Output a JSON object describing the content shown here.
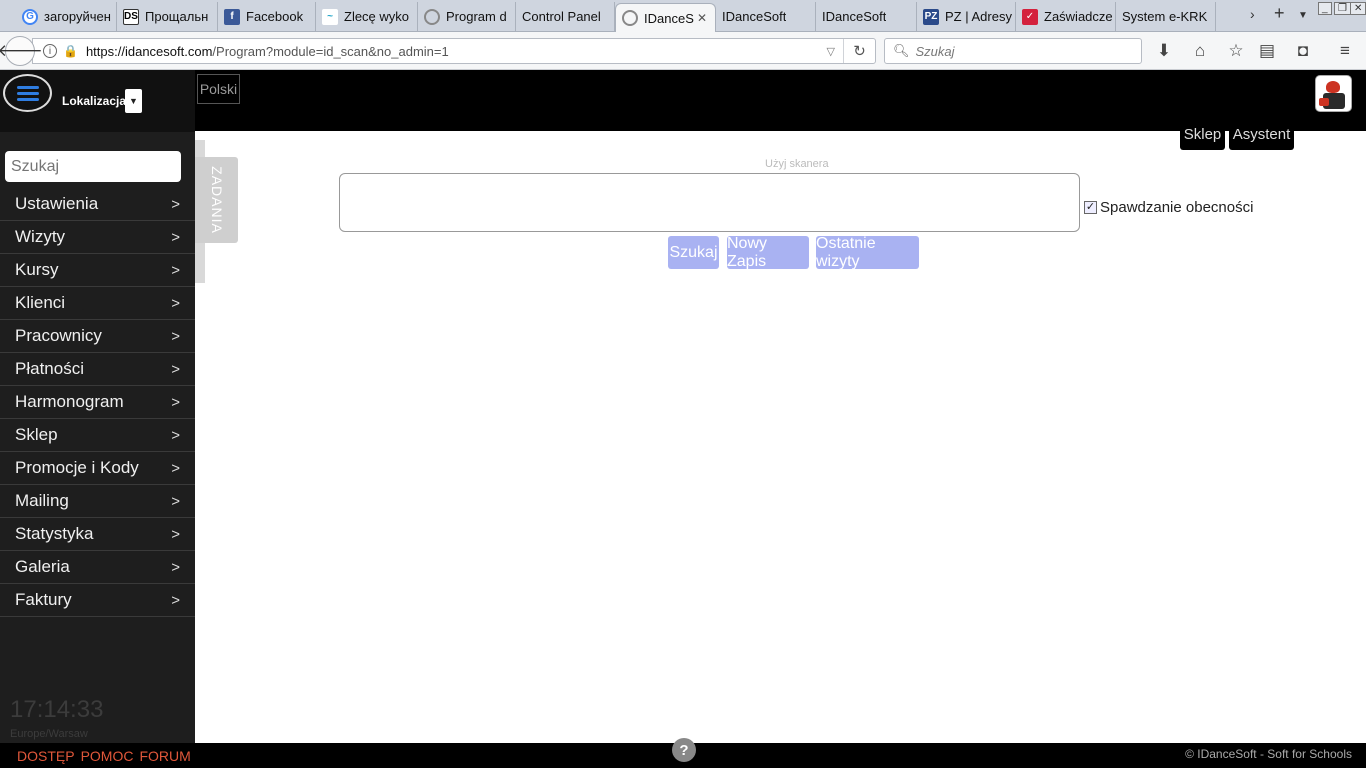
{
  "browser": {
    "tabs": [
      {
        "title": "загоруйчен",
        "fav": "G",
        "cls": "fav-g"
      },
      {
        "title": "Прощальн",
        "fav": "DS",
        "cls": "fav-ds"
      },
      {
        "title": "Facebook",
        "fav": "f",
        "cls": "fav-fb"
      },
      {
        "title": "Zlecę wyko",
        "fav": "~",
        "cls": "fav-z"
      },
      {
        "title": "Program d",
        "fav": "",
        "cls": "fav-ring"
      },
      {
        "title": "Control Panel",
        "fav": "",
        "cls": ""
      },
      {
        "title": "IDanceS",
        "fav": "",
        "cls": "fav-ring",
        "active": true
      },
      {
        "title": "IDanceSoft",
        "fav": "",
        "cls": ""
      },
      {
        "title": "IDanceSoft",
        "fav": "",
        "cls": ""
      },
      {
        "title": "PZ | Adresy",
        "fav": "PZ",
        "cls": "fav-pz"
      },
      {
        "title": "Zaświadcze",
        "fav": "✓",
        "cls": "fav-za"
      },
      {
        "title": "System e-KRK",
        "fav": "",
        "cls": ""
      }
    ],
    "url_host": "https://idancesoft.com",
    "url_path": "/Program?module=id_scan&no_admin=1",
    "search_placeholder": "Szukaj"
  },
  "sidebar": {
    "location_label": "Lokalizacja",
    "search_placeholder": "Szukaj",
    "menu": [
      {
        "label": "Ustawienia"
      },
      {
        "label": "Wizyty"
      },
      {
        "label": "Kursy"
      },
      {
        "label": "Klienci"
      },
      {
        "label": "Pracownicy"
      },
      {
        "label": "Płatności"
      },
      {
        "label": "Harmonogram"
      },
      {
        "label": "Sklep"
      },
      {
        "label": "Promocje i Kody"
      },
      {
        "label": "Mailing"
      },
      {
        "label": "Statystyka"
      },
      {
        "label": "Galeria"
      },
      {
        "label": "Faktury"
      }
    ],
    "arrow": ">",
    "clock": "17:14:33",
    "timezone": "Europe/Warsaw"
  },
  "header": {
    "language": "Polski",
    "shop_label": "Sklep",
    "assistant_label": "Asystent"
  },
  "tasks_tab": "ZADANIA",
  "main": {
    "scanner_label": "Użyj skanera",
    "attendance_label": "Spawdzanie obecności",
    "attendance_checked": true,
    "buttons": {
      "search": "Szukaj",
      "new_entry": "Nowy Zapis",
      "recent_visits": "Ostatnie wizyty"
    }
  },
  "footer": {
    "links": [
      "DOSTĘP",
      "POMOC",
      "FORUM"
    ],
    "help": "?",
    "copyright": "© IDanceSoft - Soft for Schools"
  },
  "colors": {
    "button_bg": "#a9b2f2",
    "footer_link": "#e0573a",
    "sidebar_bg": "#1e1e1e"
  }
}
